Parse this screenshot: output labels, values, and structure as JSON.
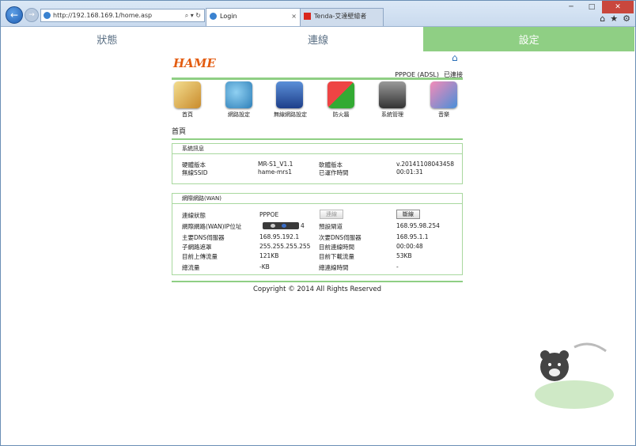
{
  "browser": {
    "url": "http://192.168.169.1/home.asp",
    "address_controls": "⌕ ▾ ↻",
    "tabs": [
      {
        "label": "Login",
        "close": "×"
      },
      {
        "label": "Tenda-艾達壁繪者",
        "close": ""
      }
    ]
  },
  "nav": {
    "tabs": [
      "狀態",
      "連線",
      "設定"
    ],
    "active": 2
  },
  "header": {
    "logo": "HAME",
    "conn_type": "PPPOE (ADSL)",
    "conn_state": "已連接"
  },
  "icons": [
    {
      "label": "首頁",
      "name": "home-menu-icon"
    },
    {
      "label": "網路設定",
      "name": "network-settings-icon"
    },
    {
      "label": "無線網路設定",
      "name": "wireless-settings-icon"
    },
    {
      "label": "防火牆",
      "name": "firewall-icon"
    },
    {
      "label": "系統管理",
      "name": "system-admin-icon"
    },
    {
      "label": "音樂",
      "name": "music-icon"
    }
  ],
  "page_title": "首頁",
  "system": {
    "title": "系統訊息",
    "rows": [
      {
        "l1": "硬體版本",
        "v1": "MR-S1_V1.1",
        "l2": "軟體版本",
        "v2": "v.20141108043458"
      },
      {
        "l1": "無線SSID",
        "v1": "hame-mrs1",
        "l2": "已運作時間",
        "v2": "00:01:31"
      }
    ]
  },
  "wan": {
    "title": "網際網路(WAN)",
    "status_label": "連線狀態",
    "status_value": "PPPOE",
    "btn_disabled": "連線",
    "btn_disconnect": "斷線",
    "ip_label": "網際網路(WAN)IP位址",
    "ip_value_tail": "4",
    "gateway_label": "預設閘道",
    "gateway_value": "168.95.98.254",
    "dns1_label": "主要DNS伺服器",
    "dns1_value": "168.95.192.1",
    "dns2_label": "次要DNS伺服器",
    "dns2_value": "168.95.1.1",
    "mask_label": "子網路遮罩",
    "mask_value": "255.255.255.255",
    "conn_time_label": "目前連線時間",
    "conn_time_value": "00:00:48",
    "up_label": "目前上傳流量",
    "up_value": "121KB",
    "down_label": "目前下載流量",
    "down_value": "53KB",
    "total_label": "總流量",
    "total_value": "-KB",
    "total_time_label": "總連線時間",
    "total_time_value": "-"
  },
  "footer": "Copyright © 2014 All Rights Reserved",
  "colors": {
    "accent": "#8fcf84",
    "logo": "#e35c10"
  }
}
